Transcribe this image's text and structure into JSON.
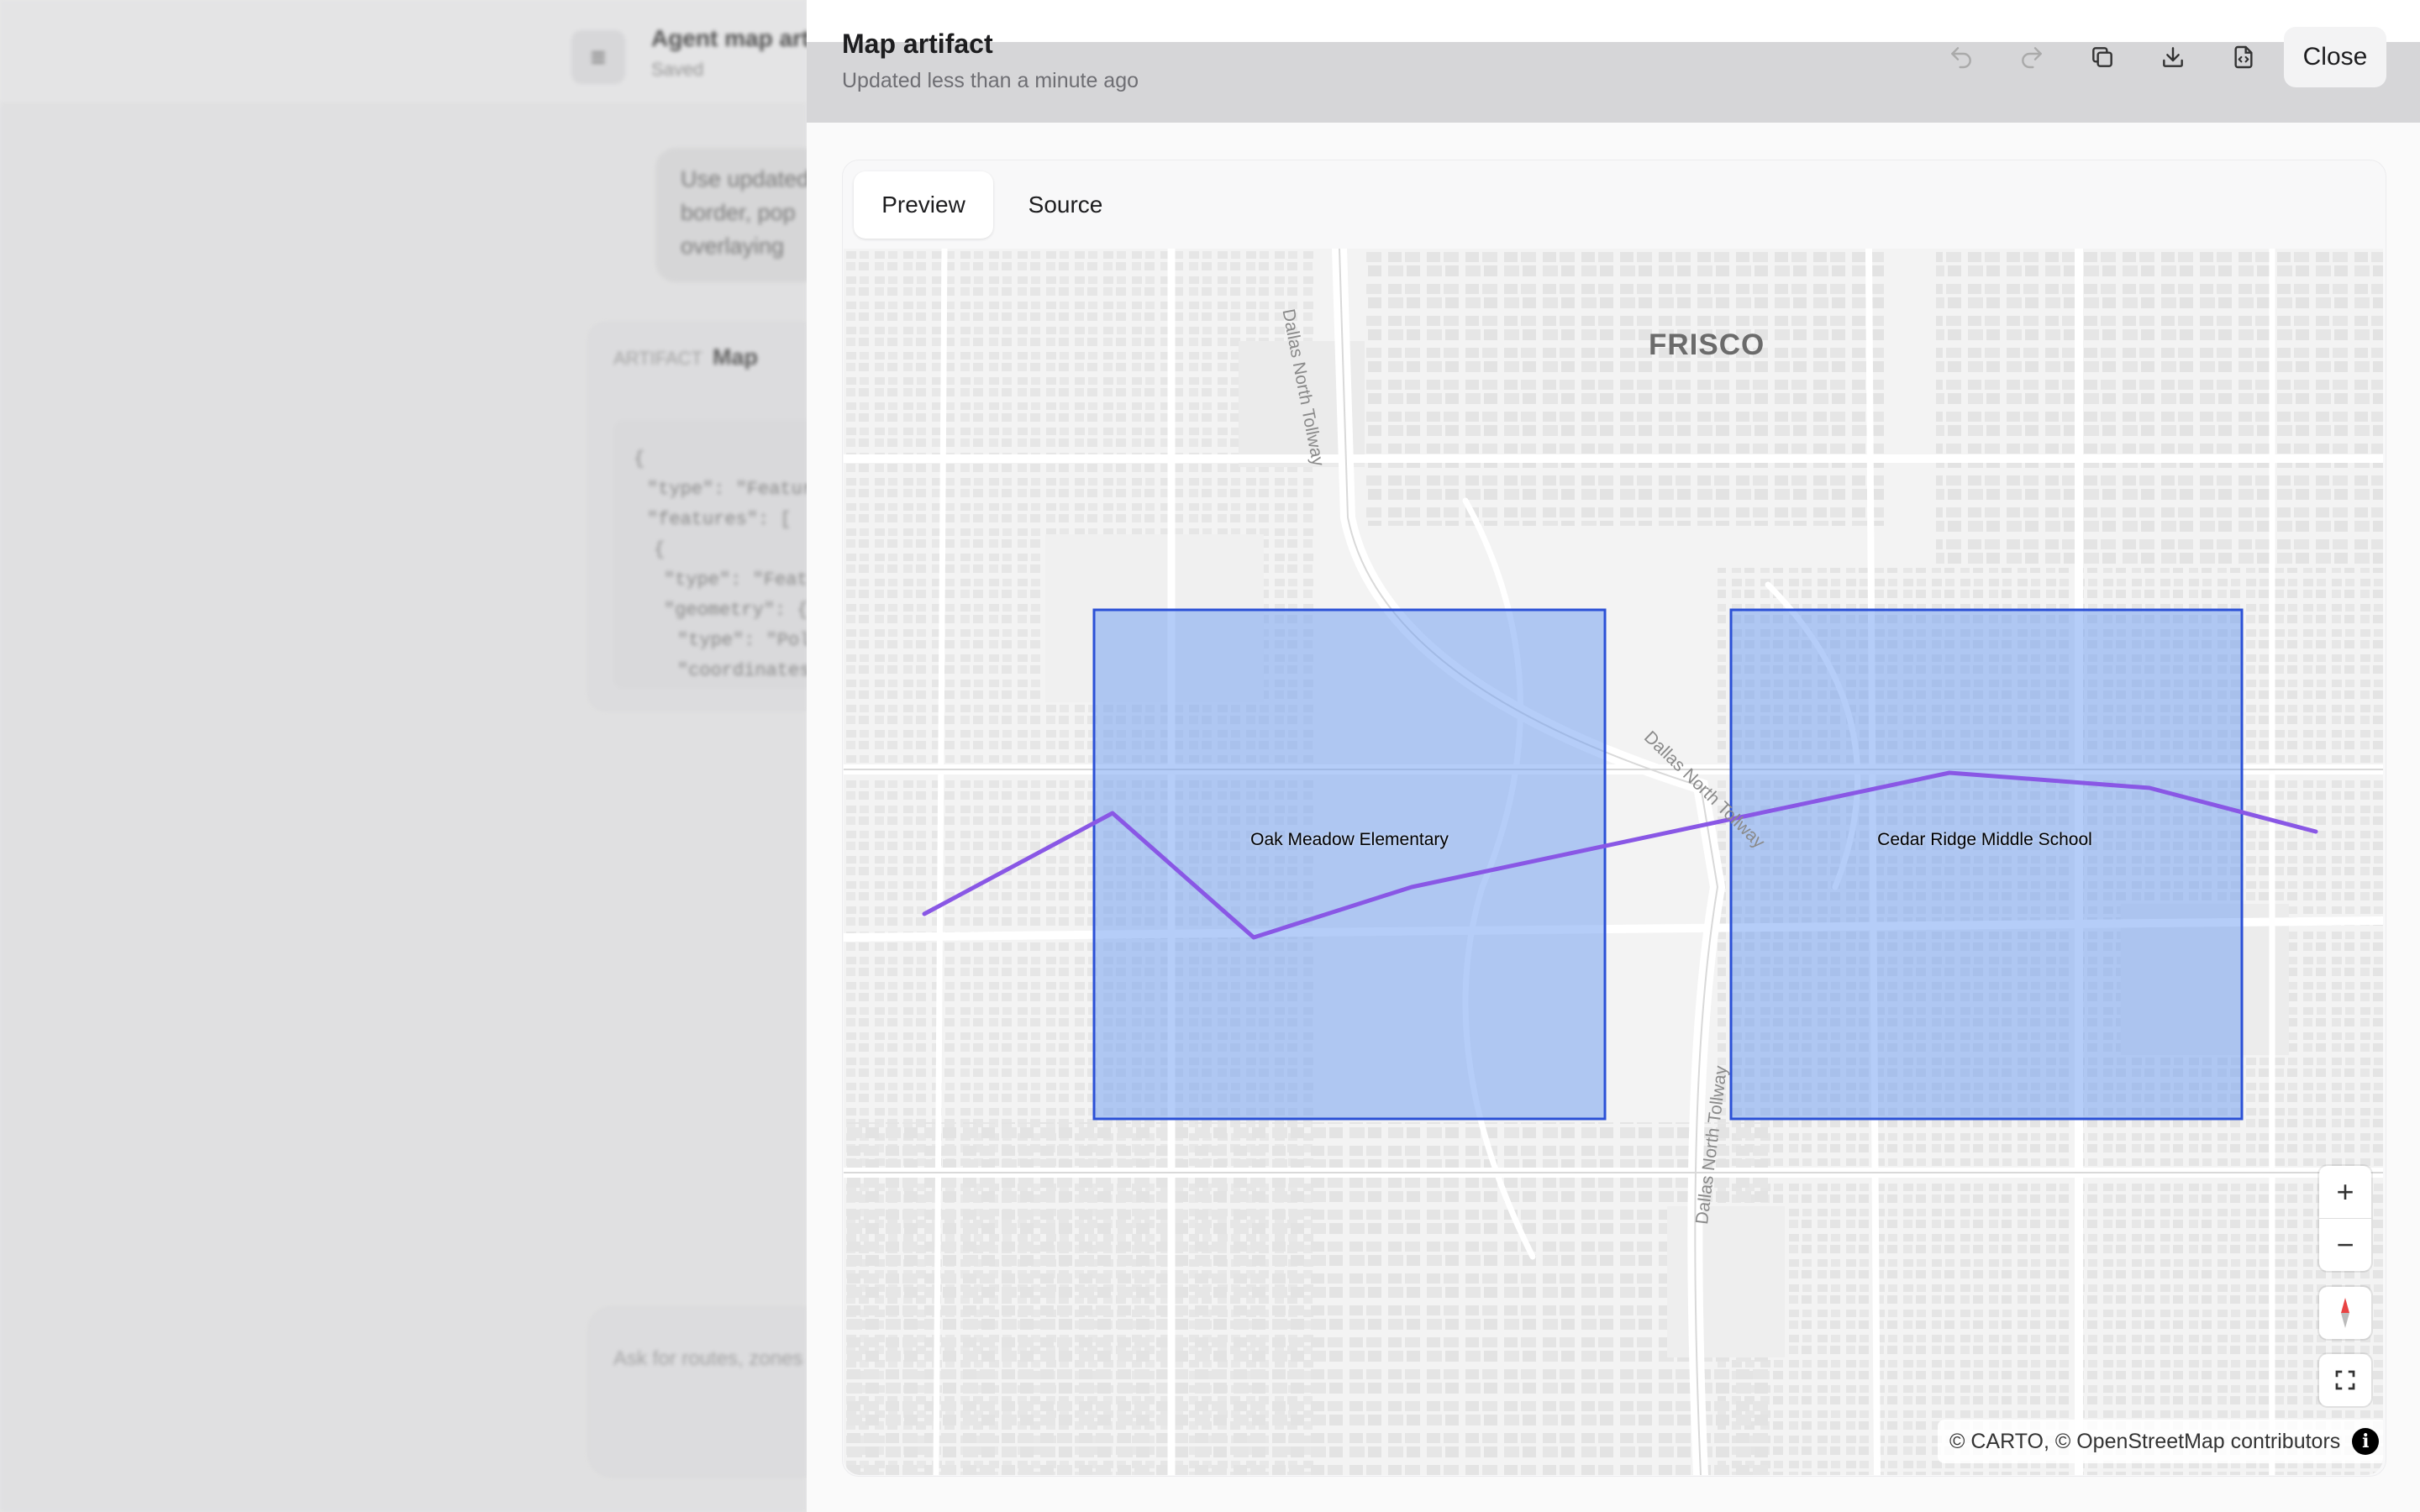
{
  "background": {
    "chat_title": "Agent map artifact",
    "chat_subtitle": "Saved",
    "user_message_lines": [
      "Use updated",
      "border, pop",
      "overlaying"
    ],
    "artifact_card_tag": "ARTIFACT",
    "artifact_card_name": "Map",
    "code_lines": [
      "{",
      "\"type\": \"FeatureCollection\",",
      "\"features\": [",
      "{",
      "\"type\": \"Feature\",",
      "\"geometry\": {",
      "\"type\": \"Polygon\",",
      "\"coordinates\": ["
    ],
    "composer_placeholder": "Ask for routes, zones"
  },
  "panel": {
    "title": "Map artifact",
    "subtitle": "Updated less than a minute ago",
    "close_label": "Close",
    "toolbar_icons": [
      "undo-icon",
      "redo-icon",
      "copy-icon",
      "download-icon",
      "code-file-icon"
    ]
  },
  "tabs": [
    {
      "label": "Preview",
      "active": true
    },
    {
      "label": "Source",
      "active": false
    }
  ],
  "map": {
    "city_label": "FRISCO",
    "road_labels": [
      "Dallas North Tollway",
      "Dallas North Tollway",
      "Dallas North Tollway"
    ],
    "zones": [
      {
        "name": "Oak Meadow Elementary",
        "fill": "#6b9bf2",
        "stroke": "#2b50d6"
      },
      {
        "name": "Cedar Ridge Middle School",
        "fill": "#6b9bf2",
        "stroke": "#2b50d6"
      }
    ],
    "route_color": "#8957e5",
    "controls": {
      "zoom_in": "+",
      "zoom_out": "−",
      "fullscreen": "⛶"
    },
    "attribution": "© CARTO, © OpenStreetMap contributors",
    "attribution_info": "i"
  }
}
